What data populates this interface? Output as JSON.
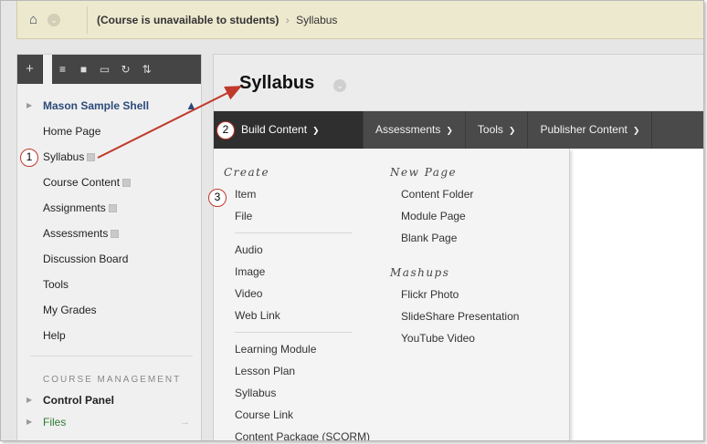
{
  "breadcrumb": {
    "course_state": "(Course is unavailable to students)",
    "separator": "›",
    "current": "Syllabus"
  },
  "icons": {
    "home": "home-icon",
    "dropdown": "chevron-down-icon",
    "add": "plus-icon",
    "list_view": "list-icon",
    "folder_view": "folder-icon",
    "window_view": "window-icon",
    "refresh": "refresh-icon",
    "sort": "sort-icon",
    "pin": "home-pin-icon"
  },
  "sidebar": {
    "course_name": "Mason Sample Shell",
    "items": [
      {
        "label": "Home Page"
      },
      {
        "label": "Syllabus"
      },
      {
        "label": "Course Content"
      },
      {
        "label": "Assignments"
      },
      {
        "label": "Assessments"
      },
      {
        "label": "Discussion Board"
      },
      {
        "label": "Tools"
      },
      {
        "label": "My Grades"
      },
      {
        "label": "Help"
      }
    ],
    "management_title": "COURSE MANAGEMENT",
    "control_panel": "Control Panel",
    "files": "Files"
  },
  "page": {
    "title": "Syllabus"
  },
  "menubar": {
    "build_content": "Build Content",
    "assessments": "Assessments",
    "tools": "Tools",
    "publisher_content": "Publisher Content"
  },
  "dropdown": {
    "create_heading": "Create",
    "create_group1": [
      "Item",
      "File"
    ],
    "create_group2": [
      "Audio",
      "Image",
      "Video",
      "Web Link"
    ],
    "create_group3": [
      "Learning Module",
      "Lesson Plan",
      "Syllabus",
      "Course Link",
      "Content Package (SCORM)"
    ],
    "new_page_heading": "New Page",
    "new_page_items": [
      "Content Folder",
      "Module Page",
      "Blank Page"
    ],
    "mashups_heading": "Mashups",
    "mashups_items": [
      "Flickr Photo",
      "SlideShare Presentation",
      "YouTube Video"
    ]
  },
  "callouts": [
    "1",
    "2",
    "3"
  ],
  "colors": {
    "breadcrumb_bg": "#ede9cf",
    "menubar_bg": "#4a4a4a",
    "callout_ring": "#c0392b",
    "course_link": "#2c4a7a",
    "files_link": "#2e7d32"
  }
}
